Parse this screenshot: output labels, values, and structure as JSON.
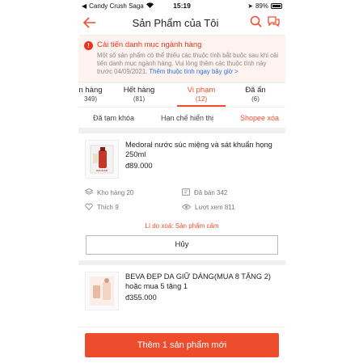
{
  "status_bar": {
    "carrier": "Candy Crush Saga",
    "time": "15:19",
    "battery": "89%"
  },
  "header": {
    "title": "Sản Phẩm của Tôi"
  },
  "alert": {
    "title": "Cải tiến danh mục ngành hàng",
    "body": "Một số sản phẩm có thể thiếu các thuộc tính bắt buộc sau khi cải tiến danh mục ngành hàng. Vui lòng thêm các thuộc tính này trước 04/09/2021.",
    "link": "Thêm thuộc tính ngay bây giờ >"
  },
  "tabs": [
    {
      "label": "n hàng",
      "count": "349)"
    },
    {
      "label": "Hết hàng",
      "count": "(81)"
    },
    {
      "label": "Vi phạm",
      "count": "(12)"
    },
    {
      "label": "Đã ẩn",
      "count": "(6)"
    }
  ],
  "subtabs": [
    "Đã tạm khóa",
    "Hạn chế hiển thị",
    "Shopee xóa"
  ],
  "products": [
    {
      "name": "Medoral nước súc miệng và sát khuẩn họng 250ml",
      "price": "đ89.000",
      "stock": "Kho hàng 20",
      "sold": "Đã bán 342",
      "likes": "Thích 9",
      "views": "Lượt xem 811",
      "reason": "Lí do xoá: Sản phẩm cấm",
      "cancel": "Hủy"
    },
    {
      "name": "BEVA ĐẸP DA GIỮ DÁNG(MUA 8 TẶNG 2) hoặc mua 5 tặng 1",
      "price": "đ355.000"
    }
  ],
  "bottom": {
    "add_button": "Thêm 1 sản phẩm mới"
  },
  "colors": {
    "accent": "#ee4d2d",
    "alert_bg": "#fff3f0",
    "link": "#2673dd"
  }
}
